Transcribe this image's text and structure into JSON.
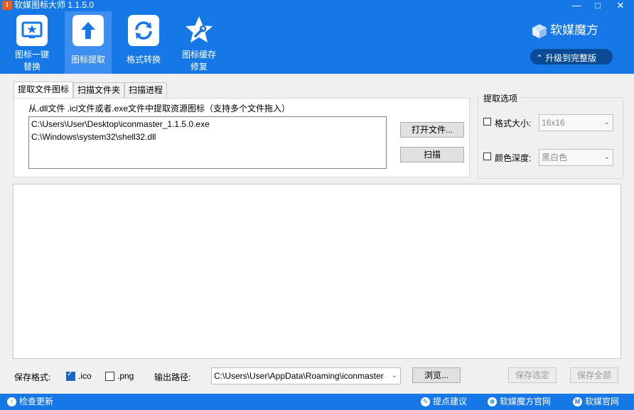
{
  "app": {
    "title": "软媒图标大师 1.1.5.0",
    "icon_letter": "I"
  },
  "window_controls": {
    "minimize": "—",
    "maximize": "□",
    "close": "✕"
  },
  "toolbar": [
    {
      "label_line1": "图标一键",
      "label_line2": "替换",
      "icon": "star-icon"
    },
    {
      "label_line1": "图标提取",
      "label_line2": "",
      "icon": "upload-arrow-icon"
    },
    {
      "label_line1": "格式转换",
      "label_line2": "",
      "icon": "refresh-icon"
    },
    {
      "label_line1": "图标缓存",
      "label_line2": "修复",
      "icon": "wrench-star-icon"
    }
  ],
  "brand": {
    "name": "软媒魔方",
    "upgrade_label": "升级到完整版"
  },
  "tabs": [
    "提取文件图标",
    "扫描文件夹",
    "扫描进程"
  ],
  "extract": {
    "description": "从.dll文件 .icl文件或者.exe文件中提取资源图标（支持多个文件拖入）",
    "files": [
      "C:\\Users\\User\\Desktop\\iconmaster_1.1.5.0.exe",
      "C:\\Windows\\system32\\shell32.dll"
    ],
    "open_button": "打开文件...",
    "scan_button": "扫描"
  },
  "options": {
    "title": "提取选项",
    "size_label": "格式大小:",
    "size_value": "16x16",
    "depth_label": "颜色深度:",
    "depth_value": "黑白色"
  },
  "bottom": {
    "format_label": "保存格式:",
    "ico_label": ".ico",
    "png_label": ".png",
    "output_label": "输出路径:",
    "output_path": "C:\\Users\\User\\AppData\\Roaming\\iconmaster",
    "browse_button": "浏览...",
    "save_selected": "保存选定",
    "save_all": "保存全部"
  },
  "statusbar": {
    "check_update": "检查更新",
    "feedback": "提点建议",
    "site_mofang": "软媒魔方官网",
    "site_ruanmei": "软媒官网"
  }
}
